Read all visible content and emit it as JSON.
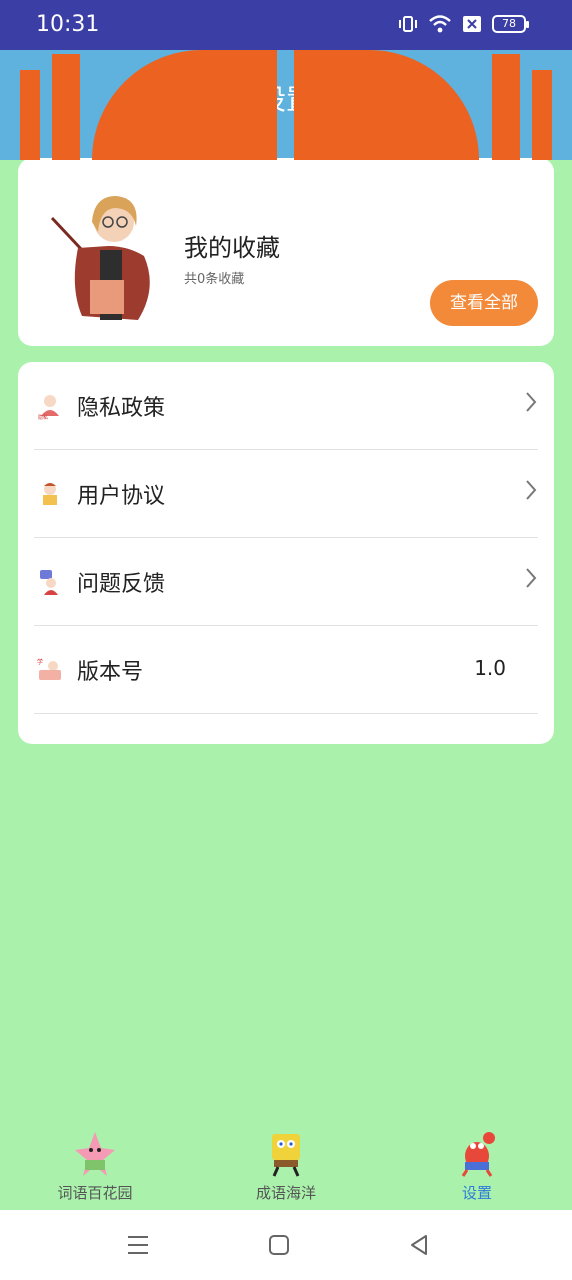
{
  "status_bar": {
    "time": "10:31",
    "battery": "78"
  },
  "header": {
    "title": "设置"
  },
  "favorites": {
    "title": "我的收藏",
    "count_text": "共0条收藏",
    "view_all_label": "查看全部"
  },
  "menu": {
    "items": [
      {
        "label": "隐私政策",
        "icon": "privacy-icon"
      },
      {
        "label": "用户协议",
        "icon": "agreement-icon"
      },
      {
        "label": "问题反馈",
        "icon": "feedback-icon"
      },
      {
        "label": "版本号",
        "icon": "version-icon",
        "value": "1.0"
      }
    ]
  },
  "tabs": [
    {
      "label": "词语百花园",
      "icon": "starfish-icon",
      "active": false
    },
    {
      "label": "成语海洋",
      "icon": "sponge-icon",
      "active": false
    },
    {
      "label": "设置",
      "icon": "crab-icon",
      "active": true
    }
  ],
  "colors": {
    "background": "#aaf2ac",
    "status_bar": "#3b3fa5",
    "header_sky": "#5fb1de",
    "header_buildings": "#ec6220",
    "accent_button": "#f28a3a",
    "tab_active": "#2f7bd8"
  }
}
